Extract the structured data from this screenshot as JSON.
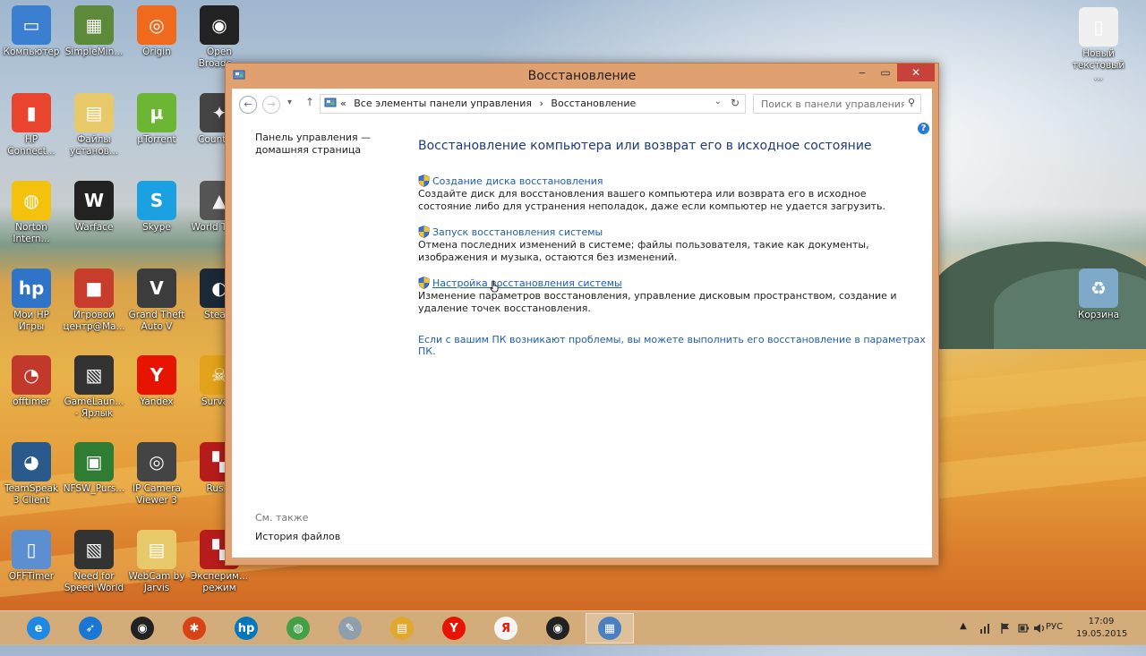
{
  "window": {
    "title": "Восстановление",
    "minimize": "‒",
    "maximize": "▭",
    "close": "✕"
  },
  "addressbar": {
    "back": "←",
    "forward": "→",
    "history_dropdown": "▾",
    "up": "↑",
    "chevron": "«",
    "crumbs": [
      "Все элементы панели управления",
      "›",
      "Восстановление"
    ],
    "dropdown": "⌄",
    "refresh": "↻",
    "search_placeholder": "Поиск в панели управления",
    "search_icon": "⚲"
  },
  "help_label": "?",
  "left_pane": {
    "home_link": "Панель управления — домашняя страница",
    "see_also": "См. также",
    "file_history": "История файлов"
  },
  "main": {
    "title": "Восстановление компьютера или возврат его в исходное состояние",
    "tasks": [
      {
        "link": "Создание диска восстановления",
        "desc": "Создайте диск для восстановления вашего компьютера или возврата его в исходное состояние либо для устранения неполадок, даже если компьютер не удается загрузить."
      },
      {
        "link": "Запуск восстановления системы",
        "desc": "Отмена последних изменений в системе; файлы пользователя, такие как документы, изображения и музыка, остаются без изменений."
      },
      {
        "link": "Настройка восстановления системы",
        "desc": "Изменение параметров восстановления, управление дисковым пространством, создание и удаление точек восстановления."
      }
    ],
    "bottom_link": "Если с вашим ПК возникают проблемы, вы можете выполнить его восстановление в параметрах ПК."
  },
  "desktop_icons": [
    {
      "label": "Компьютер",
      "glyph": "▭",
      "color": "#3b7fd0"
    },
    {
      "label": "SimpleMin...",
      "glyph": "▦",
      "color": "#5c8a3a"
    },
    {
      "label": "Origin",
      "glyph": "◎",
      "color": "#f06a1d"
    },
    {
      "label": "Open Broadc...",
      "glyph": "◉",
      "color": "#222222"
    },
    {
      "label": "HP Connect...",
      "glyph": "▮",
      "color": "#e8442e"
    },
    {
      "label": "Файлы установ...",
      "glyph": "▤",
      "color": "#e8c96a"
    },
    {
      "label": "µTorrent",
      "glyph": "µ",
      "color": "#6cb633"
    },
    {
      "label": "Counte...",
      "glyph": "✦",
      "color": "#444444"
    },
    {
      "label": "Norton Intern...",
      "glyph": "◍",
      "color": "#f4c20d"
    },
    {
      "label": "Warface",
      "glyph": "W",
      "color": "#222222"
    },
    {
      "label": "Skype",
      "glyph": "S",
      "color": "#1ba1e2"
    },
    {
      "label": "World Tanks",
      "glyph": "▲",
      "color": "#555555"
    },
    {
      "label": "Мои HP Игры",
      "glyph": "hp",
      "color": "#2f74c6"
    },
    {
      "label": "Игровой центр@Ma...",
      "glyph": "■",
      "color": "#c83c2c"
    },
    {
      "label": "Grand Theft Auto V",
      "glyph": "V",
      "color": "#3c3c3c"
    },
    {
      "label": "Stea...",
      "glyph": "◐",
      "color": "#1b2838"
    },
    {
      "label": "offtimer",
      "glyph": "◔",
      "color": "#c0392b"
    },
    {
      "label": "GameLaun... - Ярлык",
      "glyph": "▧",
      "color": "#333333"
    },
    {
      "label": "Yandex",
      "glyph": "Y",
      "color": "#e61400"
    },
    {
      "label": "Surva...",
      "glyph": "☠",
      "color": "#e2a21b"
    },
    {
      "label": "TeamSpeak 3 Client",
      "glyph": "◕",
      "color": "#2a5a8c"
    },
    {
      "label": "NFSW_Purs...",
      "glyph": "▣",
      "color": "#2e7d32"
    },
    {
      "label": "IP Camera Viewer 3",
      "glyph": "◎",
      "color": "#444444"
    },
    {
      "label": "Rus...",
      "glyph": "▚",
      "color": "#b71c1c"
    },
    {
      "label": "OFFTimer",
      "glyph": "▯",
      "color": "#5b8fd0"
    },
    {
      "label": "Need for Speed World",
      "glyph": "▧",
      "color": "#333333"
    },
    {
      "label": "WebCam by Jarvis",
      "glyph": "▤",
      "color": "#e8c96a"
    },
    {
      "label": "Эксперим... режим",
      "glyph": "▚",
      "color": "#b71c1c"
    },
    {
      "label": "Новый текстовый ...",
      "glyph": "▯",
      "color": "#f0f0f0"
    },
    {
      "label": "Корзина",
      "glyph": "♻",
      "color": "#7fa9c9"
    }
  ],
  "taskbar": {
    "items": [
      {
        "name": "internet-explorer",
        "glyph": "e",
        "color": "#1e88e5"
      },
      {
        "name": "rocket-app",
        "glyph": "➶",
        "color": "#1976d2"
      },
      {
        "name": "webcam-app",
        "glyph": "◉",
        "color": "#222222"
      },
      {
        "name": "bluestacks-app",
        "glyph": "✱",
        "color": "#d84315"
      },
      {
        "name": "hp-app",
        "glyph": "hp",
        "color": "#0277bd"
      },
      {
        "name": "chrome",
        "glyph": "◍",
        "color": "#43a047"
      },
      {
        "name": "paint-app",
        "glyph": "✎",
        "color": "#8e9eab"
      },
      {
        "name": "file-explorer",
        "glyph": "▤",
        "color": "#e0a82e"
      },
      {
        "name": "yandex-browser",
        "glyph": "Y",
        "color": "#e61400"
      },
      {
        "name": "yandex-app",
        "glyph": "Я",
        "color": "#f5f5f5"
      },
      {
        "name": "obs-app",
        "glyph": "◉",
        "color": "#222222"
      },
      {
        "name": "control-panel",
        "glyph": "▦",
        "color": "#4a7fc0"
      }
    ],
    "tray_arrow": "▲",
    "language": "РУС",
    "time": "17:09",
    "date": "19.05.2015"
  }
}
